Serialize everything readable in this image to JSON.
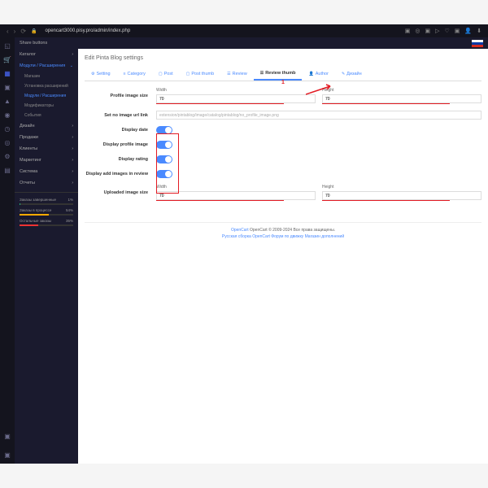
{
  "browser": {
    "url": "opencart3000.pisy.pro/admin/index.php"
  },
  "sidebar": {
    "share": "Share buttons",
    "catalog": "Каталог",
    "modules": "Модули / Расширения",
    "subs": [
      "Магазин",
      "Установка расширений",
      "Модули / Расширения",
      "Модификаторы",
      "События"
    ],
    "design": "Дизайн",
    "sales": "Продажи",
    "clients": "Клиенты",
    "marketing": "Маркетинг",
    "system": "Система",
    "reports": "Отчеты"
  },
  "stats": [
    {
      "label": "Заказы завершенные",
      "val": "1%",
      "w": "1%",
      "c": "#2a7"
    },
    {
      "label": "Заказы в процессе",
      "val": "54%",
      "w": "54%",
      "c": "#fa0"
    },
    {
      "label": "Остальные заказы",
      "val": "35%",
      "w": "35%",
      "c": "#e33"
    }
  ],
  "page": {
    "title": "Edit Pinta Blog settings",
    "annot": "1"
  },
  "tabs": [
    "Setting",
    "Category",
    "Post",
    "Post thumb",
    "Review",
    "Review thumb",
    "Author",
    "Дизайн"
  ],
  "tabIcons": [
    "⚙",
    "≡",
    "▢",
    "▢",
    "☰",
    "☰",
    "👤",
    "✎"
  ],
  "form": {
    "profile_size": "Profile image size",
    "width": "Width",
    "height": "Height",
    "w1": "70",
    "h1": "70",
    "no_image": "Set no image url link",
    "no_image_val": "extension/pintablog/image/catalog/pintablog/no_profile_image.png",
    "disp_date": "Display date",
    "disp_profile": "Display profile image",
    "disp_rating": "Display rating",
    "disp_add": "Display add images in review",
    "uploaded": "Uploaded image size",
    "w2": "70",
    "h2": "70"
  },
  "footer": {
    "copyright": "OpenCart © 2009-2024 Все права защищены.",
    "links": "Русская сборка OpenCart   Форум по движку   Магазин дополнений"
  }
}
